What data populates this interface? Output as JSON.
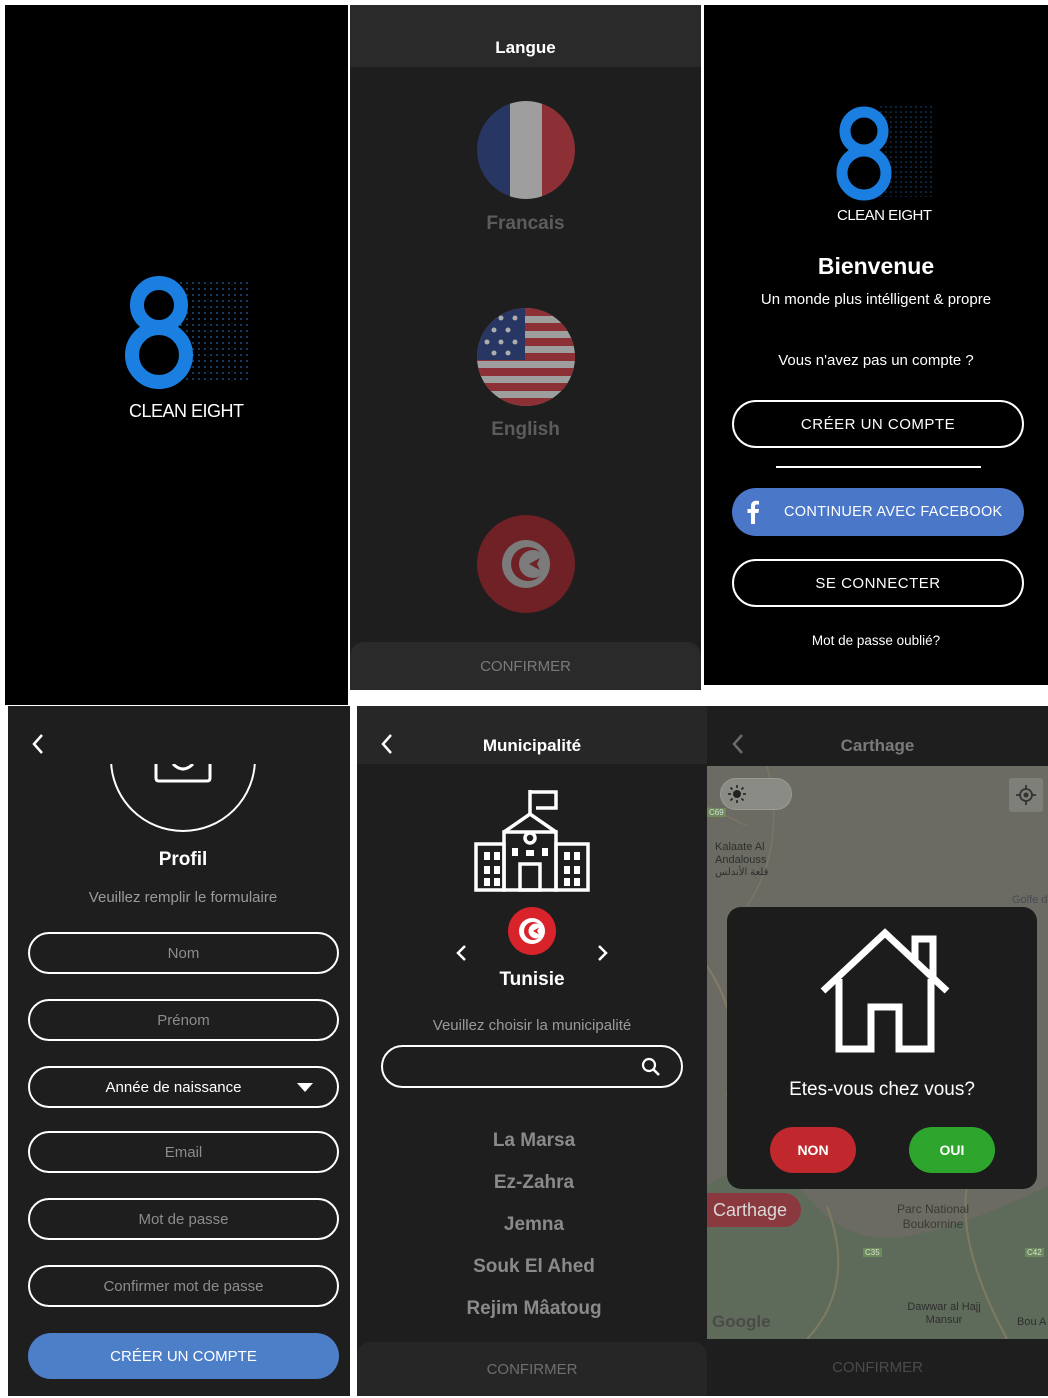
{
  "splash": {
    "brand": "CLEAN EIGHT"
  },
  "language_screen": {
    "title": "Langue",
    "languages": [
      {
        "label": "Francais",
        "flag": "france-flag"
      },
      {
        "label": "English",
        "flag": "usa-flag"
      },
      {
        "label": "",
        "flag": "tunisia-flag"
      }
    ],
    "confirm_label": "CONFIRMER"
  },
  "welcome_screen": {
    "brand": "CLEAN EIGHT",
    "title": "Bienvenue",
    "subtitle": "Un monde plus intélligent & propre",
    "no_account_text": "Vous n'avez pas un compte ?",
    "create_account_label": "CRÉER UN COMPTE",
    "facebook_label": "CONTINUER AVEC FACEBOOK",
    "login_label": "SE CONNECTER",
    "forgot_password": "Mot de passe oublié?",
    "facebook_color": "#4a77c8"
  },
  "signup_screen": {
    "title": "Créer un compte",
    "profile_label": "Profil",
    "instructions": "Veuillez remplir le formulaire",
    "fields": {
      "nom": "Nom",
      "prenom": "Prénom",
      "birth_year": "Année de naissance",
      "email": "Email",
      "password": "Mot de passe",
      "confirm_password": "Confirmer mot de passe"
    },
    "submit_label": "CRÉER UN COMPTE",
    "submit_color": "#4d7fc9"
  },
  "municipality_screen": {
    "title": "Municipalité",
    "country": "Tunisie",
    "prompt": "Veuillez choisir la municipalité",
    "search_value": "",
    "municipalities": [
      "La Marsa",
      "Ez-Zahra",
      "Jemna",
      "Souk El Ahed",
      "Rejim Mâatoug"
    ],
    "confirm_label": "CONFIRMER"
  },
  "map_screen": {
    "title": "Carthage",
    "map_labels": {
      "kalaate": "Kalaate Al Andalouss",
      "kalaate_ar": "قلعة الأندلس",
      "parc": "Parc National Boukornine",
      "dawwar": "Dawwar al Hajj Mansur",
      "bou": "Bou A",
      "golfe": "Golfe d",
      "c35": "C35",
      "c42": "C42",
      "c69": "C69",
      "google": "Google"
    },
    "location_chip": "Carthage",
    "dialog_question": "Etes-vous chez vous?",
    "no_label": "NON",
    "yes_label": "OUI",
    "no_color": "#c0282d",
    "yes_color": "#2ea62e",
    "confirm_label": "CONFIRMER"
  }
}
